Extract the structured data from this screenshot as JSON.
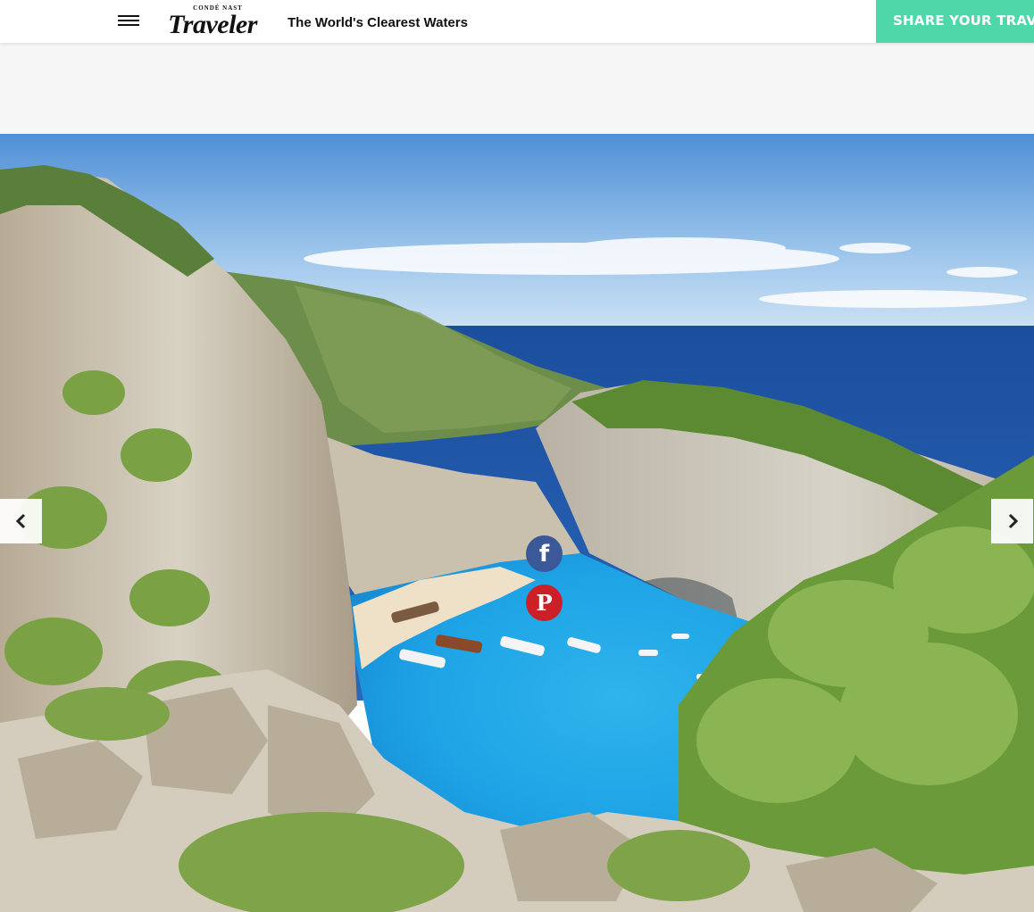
{
  "header": {
    "logo_small": "CONDÉ NAST",
    "logo_big": "Traveler",
    "title": "The World's Clearest Waters",
    "cta_label": "SHARE YOUR TRAVEL EXPERIENCE",
    "cta_color": "#4fd6a9"
  },
  "slideshow": {
    "prev_icon": "chevron-left-icon",
    "next_icon": "chevron-right-icon"
  },
  "share": {
    "facebook_glyph": "f",
    "facebook_color": "#3b5998",
    "pinterest_glyph": "P",
    "pinterest_color": "#cb2027"
  }
}
